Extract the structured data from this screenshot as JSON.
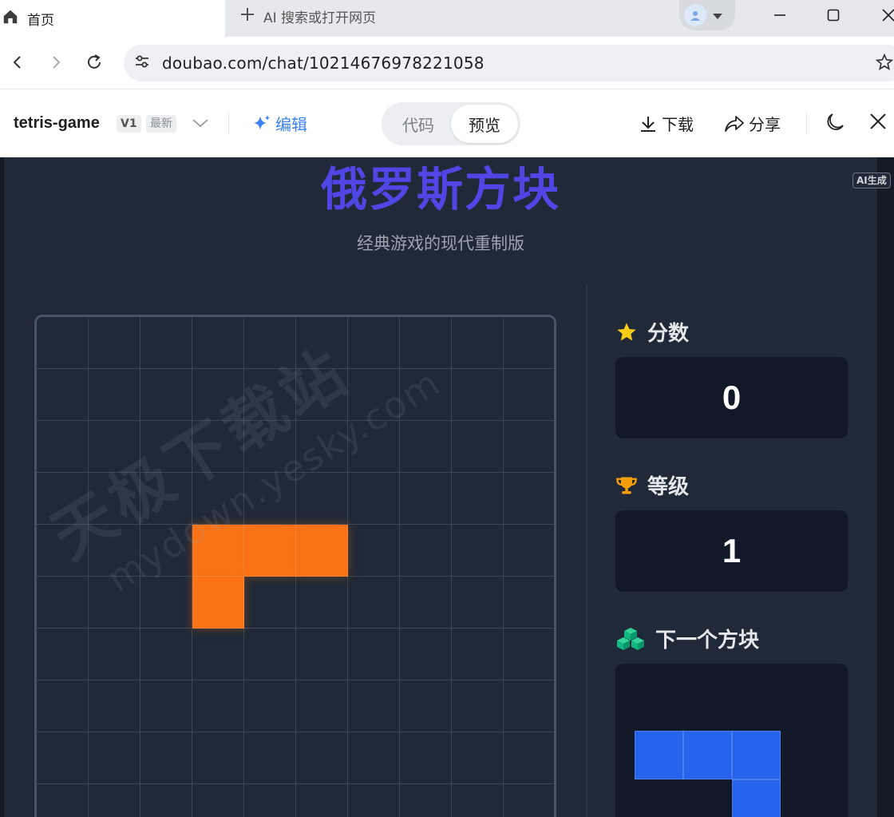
{
  "browser": {
    "active_tab_title": "首页",
    "new_tab_title": "AI 搜索或打开网页",
    "url": "doubao.com/chat/10214676978221058"
  },
  "app_toolbar": {
    "project_name": "tetris-game",
    "version": "V1",
    "version_state": "最新",
    "edit_label": "编辑",
    "code_tab": "代码",
    "preview_tab": "预览",
    "download_label": "下载",
    "share_label": "分享"
  },
  "preview": {
    "ai_tag": "AI生成",
    "title": "俄罗斯方块",
    "subtitle": "经典游戏的现代重制版",
    "watermark_line1": "天极下载站",
    "watermark_line2": "mydown.yesky.com",
    "board": {
      "columns": 10,
      "visible_rows": 10,
      "filled_cells": [
        [
          3,
          4
        ],
        [
          4,
          4
        ],
        [
          5,
          4
        ],
        [
          3,
          5
        ]
      ],
      "piece_color": "#f97316"
    },
    "score": {
      "label": "分数",
      "value": "0"
    },
    "level": {
      "label": "等级",
      "value": "1"
    },
    "next": {
      "label": "下一个方块",
      "cells": [
        [
          0,
          0
        ],
        [
          1,
          0
        ],
        [
          2,
          0
        ],
        [
          2,
          1
        ]
      ],
      "piece_color": "#2563eb"
    }
  },
  "colors": {
    "accent_title": "#4f46e5",
    "accent_link": "#3b82f6",
    "star": "#facc15",
    "trophy": "#f59e0b",
    "cubes": "#10b981"
  }
}
